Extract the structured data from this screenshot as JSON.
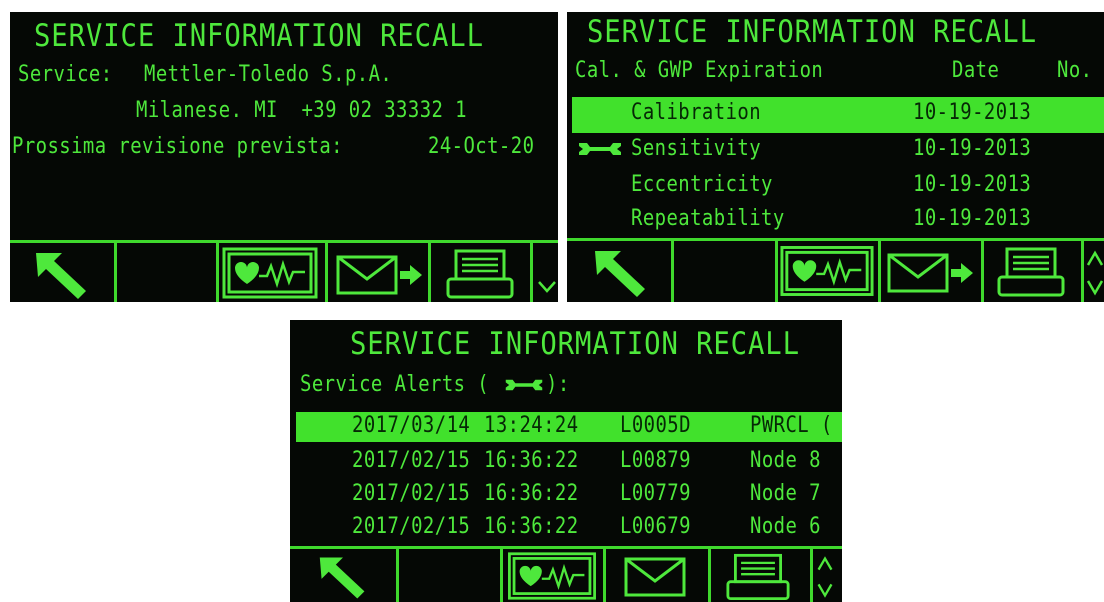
{
  "panel1": {
    "title": "SERVICE INFORMATION RECALL",
    "service_label": "Service:",
    "service_company": "Mettler-Toledo S.p.A.",
    "service_address": "Milanese. MI  +39 02 33332 1",
    "next_revision_label": "Prossima revisione prevista:",
    "next_revision_date": "24-Oct-20"
  },
  "panel2": {
    "title": "SERVICE INFORMATION RECALL",
    "header_label": "Cal. & GWP Expiration",
    "header_date": "Date",
    "header_no": "No.",
    "rows": [
      {
        "name": "Calibration",
        "date": "10-19-2013",
        "selected": true
      },
      {
        "name": "Sensitivity",
        "date": "10-19-2013",
        "wrench": true
      },
      {
        "name": "Eccentricity",
        "date": "10-19-2013"
      },
      {
        "name": "Repeatability",
        "date": "10-19-2013"
      }
    ]
  },
  "panel3": {
    "title": "SERVICE INFORMATION RECALL",
    "alerts_label_pre": "Service Alerts (",
    "alerts_label_post": "):",
    "rows": [
      {
        "date": "2017/03/14",
        "time": "13:24:24",
        "code": "L0005D",
        "node": "PWRCL (",
        "selected": true
      },
      {
        "date": "2017/02/15",
        "time": "16:36:22",
        "code": "L00879",
        "node": "Node 8"
      },
      {
        "date": "2017/02/15",
        "time": "16:36:22",
        "code": "L00779",
        "node": "Node 7"
      },
      {
        "date": "2017/02/15",
        "time": "16:36:22",
        "code": "L00679",
        "node": "Node 6"
      }
    ]
  },
  "softkeys": {
    "exit": "arrow-up-left-icon",
    "diagnostics": "heart-wave-icon",
    "send": "envelope-arrow-icon",
    "print": "printer-icon",
    "scroll": "chevron-up-down-icon"
  },
  "colors": {
    "display_green": "#4ee83c",
    "highlight": "#41e12c",
    "background": "#050805"
  }
}
